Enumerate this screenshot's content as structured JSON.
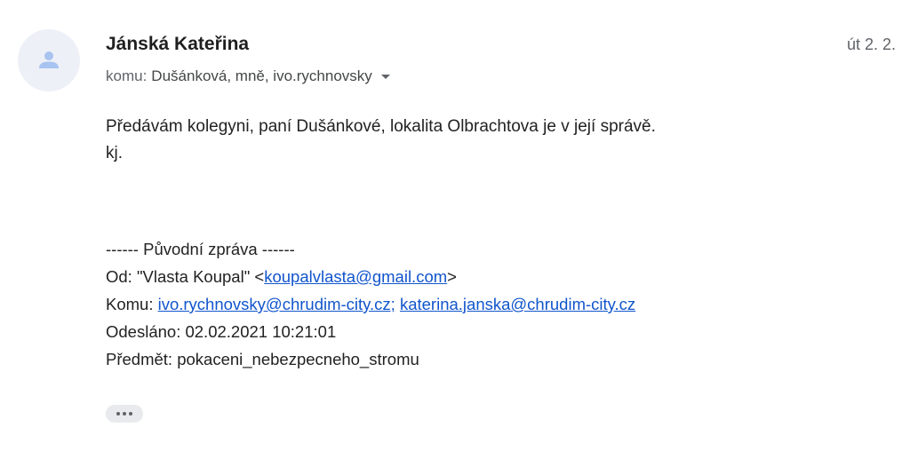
{
  "message": {
    "sender_name": "Jánská Kateřina",
    "date": "út 2. 2.",
    "recipients_prefix": "komu:",
    "recipients": "Dušánková, mně, ivo.rychnovsky",
    "body_lines": [
      "Předávám kolegyni, paní Dušánkové, lokalita Olbrachtova je v její správě.",
      "kj."
    ]
  },
  "original_message": {
    "header": "------ Původní zpráva ------",
    "from_label": "Od:",
    "from_name": "\"Vlasta Koupal\"",
    "from_open": "<",
    "from_email": "koupalvlasta@gmail.com",
    "from_close": ">",
    "to_label": "Komu:",
    "to_email_1": "ivo.rychnovsky@chrudim-city.cz;",
    "to_email_2": "katerina.janska@chrudim-city.cz",
    "sent_label": "Odesláno:",
    "sent_value": "02.02.2021 10:21:01",
    "subject_label": "Předmět:",
    "subject_value": "pokaceni_nebezpecneho_stromu"
  },
  "icons": {
    "avatar": "person-icon",
    "recipients_toggle": "chevron-down-icon",
    "show_trimmed": "more-horiz-icon"
  },
  "colors": {
    "avatar_bg": "#eef0f7",
    "avatar_fg": "#a8c3f0",
    "link": "#1155cc",
    "muted": "#5f6368"
  }
}
